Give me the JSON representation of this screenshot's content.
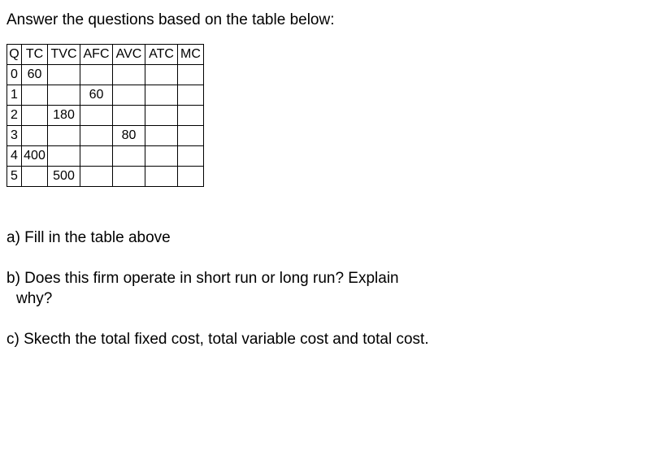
{
  "instruction": "Answer the questions based on the table below:",
  "table": {
    "headers": [
      "Q",
      "TC",
      "TVC",
      "AFC",
      "AVC",
      "ATC",
      "MC"
    ],
    "rows": [
      {
        "q": "0",
        "tc": "60",
        "tvc": "",
        "afc": "",
        "avc": "",
        "atc": "",
        "mc": ""
      },
      {
        "q": "1",
        "tc": "",
        "tvc": "",
        "afc": "60",
        "avc": "",
        "atc": "",
        "mc": ""
      },
      {
        "q": "2",
        "tc": "",
        "tvc": "180",
        "afc": "",
        "avc": "",
        "atc": "",
        "mc": ""
      },
      {
        "q": "3",
        "tc": "",
        "tvc": "",
        "afc": "",
        "avc": "80",
        "atc": "",
        "mc": ""
      },
      {
        "q": "4",
        "tc": "400",
        "tvc": "",
        "afc": "",
        "avc": "",
        "atc": "",
        "mc": ""
      },
      {
        "q": "5",
        "tc": "",
        "tvc": "500",
        "afc": "",
        "avc": "",
        "atc": "",
        "mc": ""
      }
    ]
  },
  "questions": {
    "a": "a) Fill in the table above",
    "b_line1": "b) Does this firm operate in short run or long run? Explain",
    "b_line2": "why?",
    "c": "c) Skecth the total fixed cost, total variable cost and total cost."
  },
  "chart_data": {
    "type": "table",
    "title": "Cost Table",
    "columns": [
      "Q",
      "TC",
      "TVC",
      "AFC",
      "AVC",
      "ATC",
      "MC"
    ],
    "rows": [
      [
        0,
        60,
        null,
        null,
        null,
        null,
        null
      ],
      [
        1,
        null,
        null,
        60,
        null,
        null,
        null
      ],
      [
        2,
        null,
        180,
        null,
        null,
        null,
        null
      ],
      [
        3,
        null,
        null,
        null,
        80,
        null,
        null
      ],
      [
        4,
        400,
        null,
        null,
        null,
        null,
        null
      ],
      [
        5,
        null,
        500,
        null,
        null,
        null,
        null
      ]
    ]
  }
}
